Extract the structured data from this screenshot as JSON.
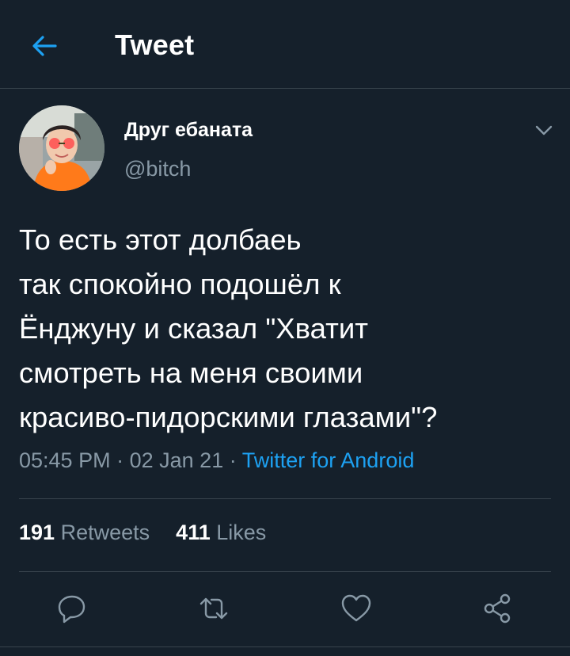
{
  "header": {
    "title": "Tweet",
    "back_icon": "arrow-left-icon"
  },
  "author": {
    "display_name": "Друг ебаната",
    "handle": "@bitch"
  },
  "tweet": {
    "text": "То есть этот долбаеь\nтак спокойно подошёл к\nЁнджуну и сказал \"Хватит\nсмотреть на меня своими\nкрасиво-пидорскими глазами\"?",
    "time": "05:45 PM",
    "date": "02 Jan 21",
    "separator": "·",
    "source": "Twitter for Android"
  },
  "stats": {
    "retweets_count": "191",
    "retweets_label": "Retweets",
    "likes_count": "411",
    "likes_label": "Likes"
  },
  "actions": [
    "reply-icon",
    "retweet-icon",
    "like-icon",
    "share-icon"
  ],
  "colors": {
    "background": "#15202b",
    "accent": "#1da1f2",
    "secondary_text": "#8899a6",
    "divider": "#38444d"
  }
}
